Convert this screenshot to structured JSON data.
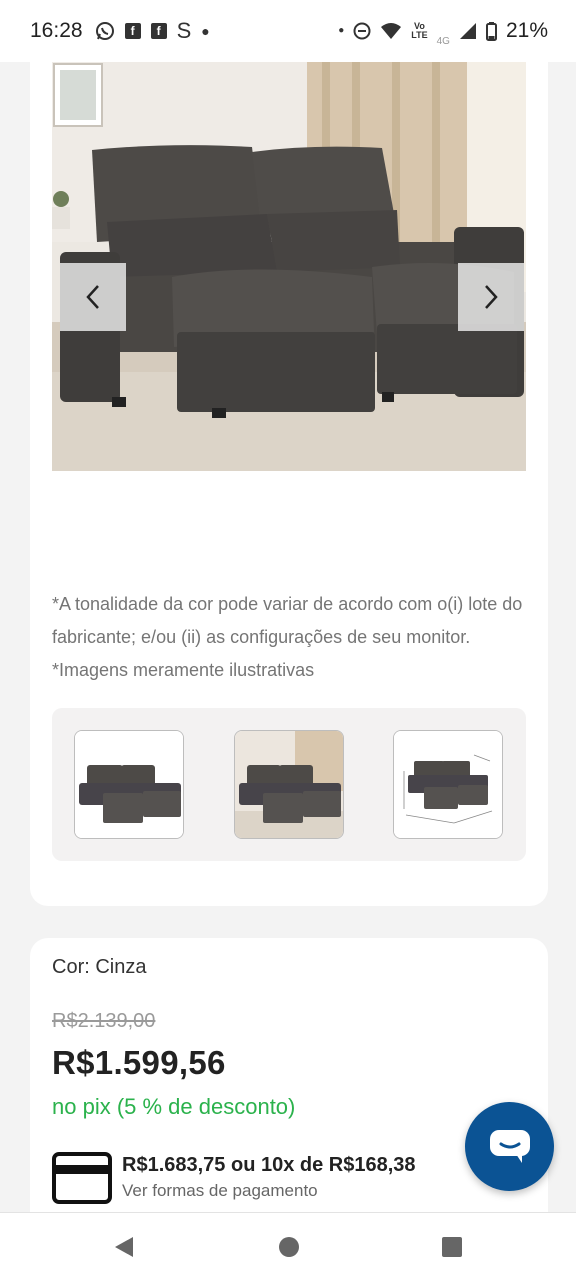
{
  "status_bar": {
    "time": "16:28",
    "left_icons": [
      "whatsapp-icon",
      "facebook-icon",
      "facebook-icon",
      "skype-icon",
      "dot-icon"
    ],
    "right_icons": [
      "dot-icon",
      "do-not-disturb-icon",
      "wifi-icon",
      "volte-icon",
      "signal-icon",
      "battery-icon"
    ],
    "volte_top": "Vo",
    "volte_bottom": "LTE",
    "network": "4G",
    "battery": "21%"
  },
  "gallery": {
    "prev_icon": "chevron-left-icon",
    "next_icon": "chevron-right-icon",
    "disclaimer": "*A tonalidade da cor pode variar de acordo com o(i) lote do fabricante; e/ou (ii) as configurações de seu monitor. *Imagens meramente ilustrativas",
    "thumbnails": [
      "sofa-front-thumbnail",
      "sofa-room-thumbnail",
      "sofa-dimensions-thumbnail"
    ]
  },
  "product": {
    "color_label": "Cor: Cinza",
    "old_price": "R$2.139,00",
    "price": "R$1.599,56",
    "pix_note": "no pix (5 % de desconto)",
    "installment_text": "R$1.683,75 ou 10x de R$168,38",
    "payment_link": "Ver formas de pagamento",
    "installment_icon": "credit-card-icon"
  },
  "chat": {
    "icon": "chat-icon"
  },
  "colors": {
    "accent_green": "#2bb24c",
    "chat_blue": "#0b5394",
    "sofa_gray": "#4a4744"
  },
  "nav": {
    "icons": [
      "back-icon",
      "home-icon",
      "recents-icon"
    ]
  }
}
